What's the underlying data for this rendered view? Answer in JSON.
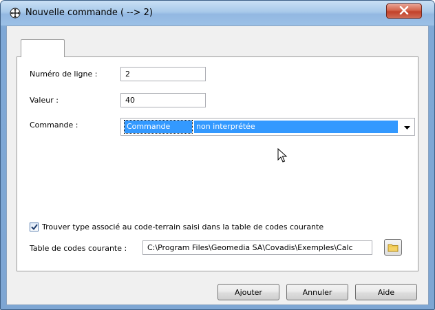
{
  "window": {
    "title": "Nouvelle commande ( --> 2)"
  },
  "form": {
    "numero_label": "Numéro de ligne :",
    "numero_value": "2",
    "valeur_label": "Valeur :",
    "valeur_value": "40",
    "commande_label": "Commande :",
    "commande_selected_code": "Commande",
    "commande_selected_desc": "non interprétée"
  },
  "options": {
    "checkbox_label": "Trouver type associé au code-terrain saisi dans la table de codes courante",
    "checkbox_checked": true,
    "table_label": "Table de codes courante :",
    "table_value": "C:\\Program Files\\Geomedia SA\\Covadis\\Exemples\\Calc"
  },
  "buttons": {
    "ajouter": "Ajouter",
    "annuler": "Annuler",
    "aide": "Aide"
  },
  "icons": {
    "app": "move-cross-icon",
    "close": "close-icon",
    "dropdown": "chevron-down-icon",
    "browse": "folder-icon",
    "cursor": "mouse-pointer-icon"
  }
}
